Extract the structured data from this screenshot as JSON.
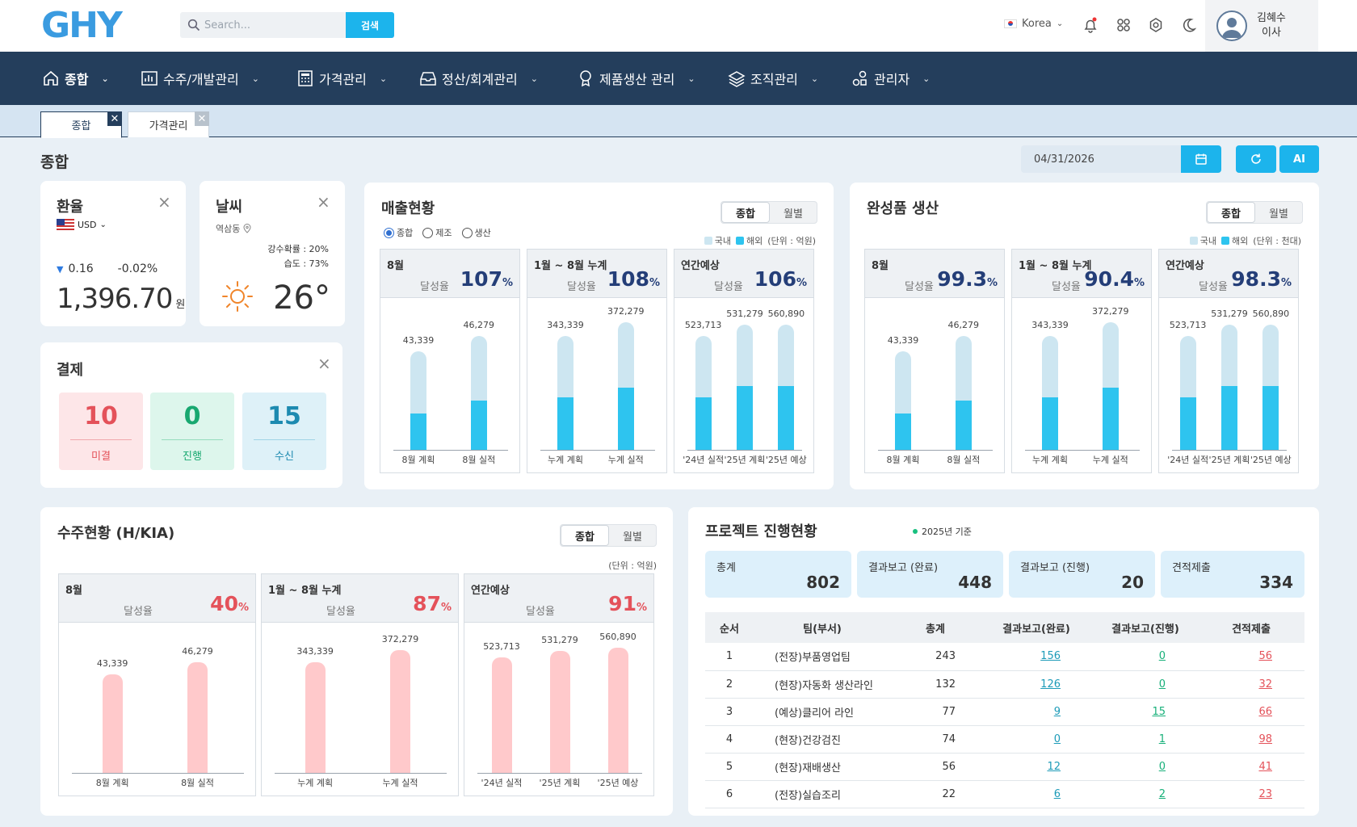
{
  "header": {
    "logo": "GHY",
    "search_placeholder": "Search...",
    "search_button": "검색",
    "language": "Korea",
    "user_name": "김혜수",
    "user_title": "이사"
  },
  "nav": [
    {
      "label": "종합",
      "icon": "home-icon"
    },
    {
      "label": "수주/개발관리",
      "icon": "chart-icon"
    },
    {
      "label": "가격관리",
      "icon": "calculator-icon"
    },
    {
      "label": "정산/회계관리",
      "icon": "inbox-icon"
    },
    {
      "label": "제품생산 관리",
      "icon": "badge-icon"
    },
    {
      "label": "조직관리",
      "icon": "layers-icon"
    },
    {
      "label": "관리자",
      "icon": "shapes-icon"
    }
  ],
  "tabs": [
    {
      "label": "종합"
    },
    {
      "label": "가격관리"
    }
  ],
  "page": {
    "title": "종합",
    "date": "04/31/2026",
    "ai_label": "AI"
  },
  "exchange": {
    "title": "환율",
    "currency": "USD",
    "change_amount": "0.16",
    "change_pct": "-0.02%",
    "rate": "1,396.70",
    "unit": "원"
  },
  "weather": {
    "title": "날씨",
    "location": "역삼동",
    "rain": "강수확률 : 20%",
    "humidity": "습도 : 73%",
    "temp": "26",
    "deg": "°"
  },
  "payment": {
    "title": "결제",
    "items": [
      {
        "value": "10",
        "label": "미결"
      },
      {
        "value": "0",
        "label": "진행"
      },
      {
        "value": "15",
        "label": "수신"
      }
    ]
  },
  "sales": {
    "title": "매출현황",
    "seg": [
      "종합",
      "월별"
    ],
    "radios": [
      "종합",
      "제조",
      "생산"
    ],
    "legend": [
      "국내",
      "해외"
    ],
    "unit": "(단위 : 억원)",
    "panels": [
      {
        "title": "8월",
        "label": "달성율",
        "pct": "107",
        "bars": [
          {
            "value": 43339,
            "display": "43,339",
            "overseas_ratio": 0.37,
            "label": "8월 계획"
          },
          {
            "value": 46279,
            "display": "46,279",
            "overseas_ratio": 0.43,
            "label": "8월 실적"
          }
        ]
      },
      {
        "title": "1월 ~ 8월 누계",
        "label": "달성율",
        "pct": "108",
        "bars": [
          {
            "value": 343339,
            "display": "343,339",
            "overseas_ratio": 0.46,
            "label": "누계 계획"
          },
          {
            "value": 372279,
            "display": "372,279",
            "overseas_ratio": 0.49,
            "label": "누계 실적"
          }
        ]
      },
      {
        "title": "연간예상",
        "label": "달성율",
        "pct": "106",
        "bars": [
          {
            "value": 523713,
            "display": "523,713",
            "overseas_ratio": 0.46,
            "label": "'24년 실적"
          },
          {
            "value": 531279,
            "display": "531,279",
            "overseas_ratio": 0.51,
            "label": "'25년 계획"
          },
          {
            "value": 560890,
            "display": "560,890",
            "overseas_ratio": 0.51,
            "label": "'25년 예상"
          }
        ]
      }
    ]
  },
  "production": {
    "title": "완성품 생산",
    "seg": [
      "종합",
      "월별"
    ],
    "legend": [
      "국내",
      "해외"
    ],
    "unit": "(단위 : 천대)",
    "panels": [
      {
        "title": "8월",
        "label": "달성율",
        "pct": "99.3",
        "bars": [
          {
            "value": 43339,
            "display": "43,339",
            "overseas_ratio": 0.37,
            "label": "8월 계획"
          },
          {
            "value": 46279,
            "display": "46,279",
            "overseas_ratio": 0.43,
            "label": "8월 실적"
          }
        ]
      },
      {
        "title": "1월 ~ 8월 누계",
        "label": "달성율",
        "pct": "90.4",
        "bars": [
          {
            "value": 343339,
            "display": "343,339",
            "overseas_ratio": 0.46,
            "label": "누계 계획"
          },
          {
            "value": 372279,
            "display": "372,279",
            "overseas_ratio": 0.49,
            "label": "누계 실적"
          }
        ]
      },
      {
        "title": "연간예상",
        "label": "달성율",
        "pct": "98.3",
        "bars": [
          {
            "value": 523713,
            "display": "523,713",
            "overseas_ratio": 0.46,
            "label": "'24년 실적"
          },
          {
            "value": 531279,
            "display": "531,279",
            "overseas_ratio": 0.51,
            "label": "'25년 계획"
          },
          {
            "value": 560890,
            "display": "560,890",
            "overseas_ratio": 0.51,
            "label": "'25년 예상"
          }
        ]
      }
    ]
  },
  "orders": {
    "title": "수주현황 (H/KIA)",
    "seg": [
      "종합",
      "월별"
    ],
    "unit": "(단위 : 억원)",
    "panels": [
      {
        "title": "8월",
        "label": "달성율",
        "pct": "40",
        "bars": [
          {
            "value": 43339,
            "display": "43,339",
            "label": "8월 계획"
          },
          {
            "value": 46279,
            "display": "46,279",
            "label": "8월 실적"
          }
        ]
      },
      {
        "title": "1월 ~ 8월 누계",
        "label": "달성율",
        "pct": "87",
        "bars": [
          {
            "value": 343339,
            "display": "343,339",
            "label": "누계 계획"
          },
          {
            "value": 372279,
            "display": "372,279",
            "label": "누계 실적"
          }
        ]
      },
      {
        "title": "연간예상",
        "label": "달성율",
        "pct": "91",
        "bars": [
          {
            "value": 523713,
            "display": "523,713",
            "label": "'24년 실적"
          },
          {
            "value": 531279,
            "display": "531,279",
            "label": "'25년 계획"
          },
          {
            "value": 560890,
            "display": "560,890",
            "label": "'25년 예상"
          }
        ]
      }
    ]
  },
  "projects": {
    "title": "프로젝트 진행현황",
    "basis": "2025년 기준",
    "summary": [
      {
        "label": "총계",
        "value": "802"
      },
      {
        "label": "결과보고 (완료)",
        "value": "448"
      },
      {
        "label": "결과보고 (진행)",
        "value": "20"
      },
      {
        "label": "견적제출",
        "value": "334"
      }
    ],
    "columns": [
      "순서",
      "팀(부서)",
      "총계",
      "결과보고(완료)",
      "결과보고(진행)",
      "견적제출"
    ],
    "rows": [
      [
        "1",
        "(전장)부품영업팀",
        "243",
        "156",
        "0",
        "56"
      ],
      [
        "2",
        "(현장)자동화 생산라인",
        "132",
        "126",
        "0",
        "32"
      ],
      [
        "3",
        "(예상)클리어 라인",
        "77",
        "9",
        "15",
        "66"
      ],
      [
        "4",
        "(현장)건강검진",
        "74",
        "0",
        "1",
        "98"
      ],
      [
        "5",
        "(현장)재배생산",
        "56",
        "12",
        "0",
        "41"
      ],
      [
        "6",
        "(전장)실습조리",
        "22",
        "6",
        "2",
        "23"
      ]
    ]
  },
  "colors": {
    "nav": "#243e5c",
    "accent": "#1cb4ec",
    "domestic": "#cde6f1",
    "overseas": "#2ec4ef",
    "order_bar": "#ffc9cb",
    "red": "#e4525a",
    "green": "#18b07a",
    "teal": "#1d9bb8"
  }
}
